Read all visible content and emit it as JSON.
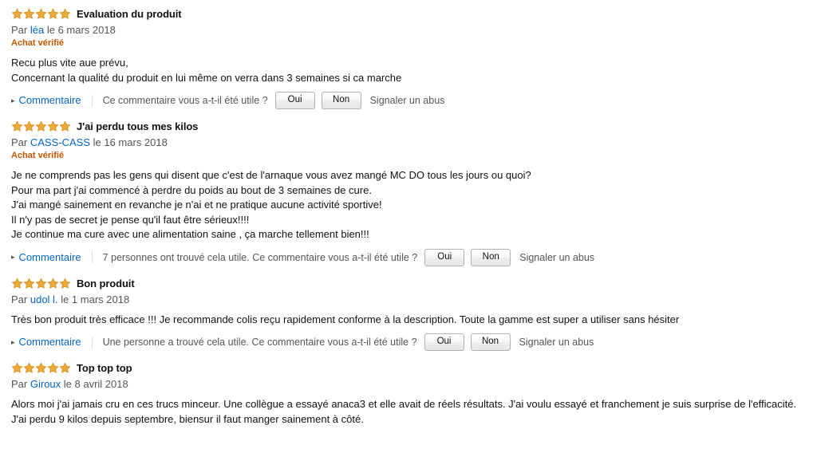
{
  "colors": {
    "star": "#eda93b",
    "star_border": "#d08706",
    "link": "#0066c0",
    "verified": "#c45500",
    "muted": "#555555",
    "text": "#111111",
    "button_border": "#adb1b8"
  },
  "labels": {
    "by": "Par",
    "verified_purchase": "Achat vérifié",
    "comment": "Commentaire",
    "helpful_question": "Ce commentaire vous a-t-il été utile ?",
    "yes": "Oui",
    "no": "Non",
    "report_abuse": "Signaler un abus",
    "caret": "▸"
  },
  "reviews": [
    {
      "rating": 5,
      "title": "Evaluation du produit",
      "author": "léa",
      "date": "le 6 mars 2018",
      "verified": true,
      "body_lines": [
        "Recu plus vite aue prévu,",
        "Concernant la qualité du produit en lui même on verra dans 3 semaines si ca marche"
      ],
      "helpful_count_text": "",
      "has_helpful_count": false
    },
    {
      "rating": 5,
      "title": "J'ai perdu tous mes kilos",
      "author": "CASS-CASS",
      "date": "le 16 mars 2018",
      "verified": true,
      "body_lines": [
        "Je ne comprends pas les gens qui disent que c'est de l'arnaque vous avez mangé MC DO tous les jours ou quoi?",
        "Pour ma part j'ai commencé à perdre du poids au bout de 3 semaines de cure.",
        "J'ai mangé sainement en revanche je n'ai et ne pratique aucune activité sportive!",
        "Il n'y pas de secret je pense qu'il faut être sérieux!!!!",
        "Je continue ma cure avec une alimentation saine , ça marche tellement bien!!!"
      ],
      "helpful_count_text": "7 personnes ont trouvé cela utile.",
      "has_helpful_count": true
    },
    {
      "rating": 5,
      "title": "Bon produit",
      "author": "udol l.",
      "date": "le 1 mars 2018",
      "verified": false,
      "body_lines": [
        "Très bon produit très efficace !!! Je recommande colis reçu rapidement conforme à la description. Toute la gamme est super a utiliser sans hésiter"
      ],
      "helpful_count_text": "Une personne a trouvé cela utile.",
      "has_helpful_count": true
    },
    {
      "rating": 5,
      "title": "Top top top",
      "author": "Giroux",
      "date": "le 8 avril 2018",
      "verified": false,
      "body_lines": [
        "Alors moi j'ai jamais cru en ces trucs minceur. Une collègue a essayé anaca3 et elle avait de réels résultats. J'ai voulu essayé et franchement je suis surprise de l'efficacité. J'ai perdu 9 kilos depuis septembre, biensur il faut manger sainement à côté."
      ],
      "helpful_count_text": "",
      "has_helpful_count": false,
      "hide_actions": true
    }
  ]
}
